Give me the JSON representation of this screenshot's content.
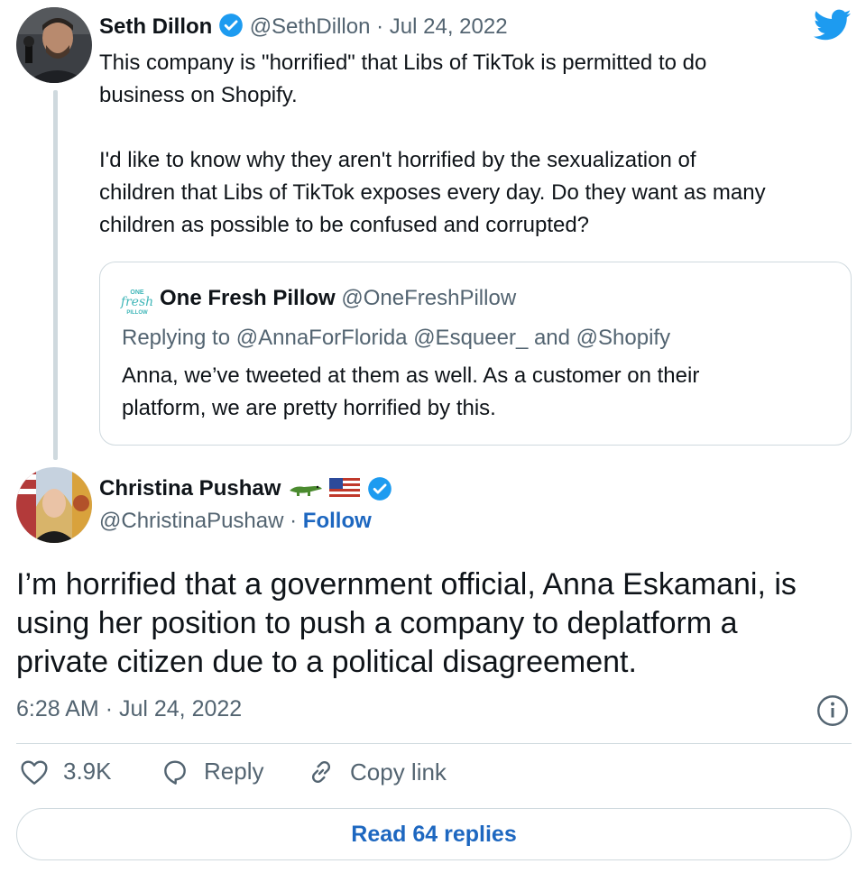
{
  "colors": {
    "accent": "#1d9bf0",
    "link": "#1d67c0",
    "muted": "#536471",
    "border": "#cfd9de"
  },
  "quoting_tweet": {
    "author_name": "Seth Dillon",
    "handle": "@SethDillon",
    "separator": "·",
    "date": "Jul 24, 2022",
    "text": "This company is \"horrified\" that Libs of TikTok is permitted to do\nbusiness on Shopify.\n\nI'd like to know why they aren't horrified by the sexualization of\nchildren that Libs of TikTok exposes every day. Do they want as many\nchildren as possible to be confused and corrupted?"
  },
  "quoted_tweet": {
    "logo_text": "ONE fresh PILLOW",
    "author_name": "One Fresh Pillow",
    "handle": "@OneFreshPillow",
    "replying_label": "Replying to",
    "replying_handles": "@AnnaForFlorida @Esqueer_ and @Shopify",
    "text": "Anna, we’ve tweeted at them as well. As a customer on their\nplatform, we are pretty horrified by this."
  },
  "main_tweet": {
    "author_name": "Christina Pushaw",
    "name_emojis": [
      "alligator-icon",
      "us-flag-icon"
    ],
    "handle": "@ChristinaPushaw",
    "separator": "·",
    "follow_label": "Follow",
    "text": "I’m horrified that a government official, Anna Eskamani, is\nusing her position to push a company to deplatform a\nprivate citizen due to a political disagreement.",
    "time": "6:28 AM",
    "date_separator": "·",
    "date": "Jul 24, 2022"
  },
  "actions": {
    "like_count": "3.9K",
    "reply_label": "Reply",
    "copy_link_label": "Copy link"
  },
  "read_replies_label": "Read 64 replies"
}
